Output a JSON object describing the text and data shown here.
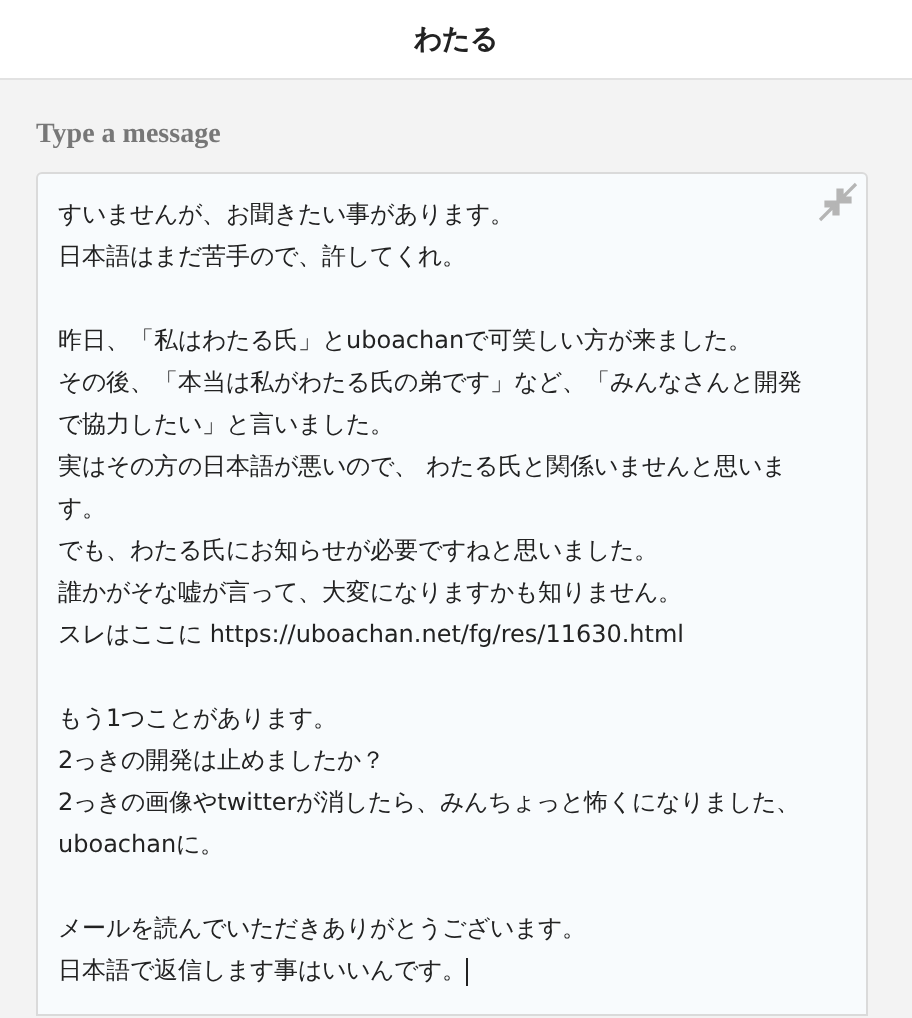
{
  "header": {
    "title": "わたる"
  },
  "composer": {
    "label": "Type a message",
    "paragraphs": [
      [
        "すいませんが、お聞きたい事があります。",
        "日本語はまだ苦手ので、許してくれ。"
      ],
      [
        "昨日、「私はわたる氏」とuboachanで可笑しい方が来ました。",
        "その後、「本当は私がわたる氏の弟です」など、「みんなさんと開発で協力したい」と言いました。",
        "実はその方の日本語が悪いので、 わたる氏と関係いませんと思います。",
        "でも、わたる氏にお知らせが必要ですねと思いました。",
        "誰かがそな嘘が言って、大変になりますかも知りません。",
        "スレはここに https://uboachan.net/fg/res/11630.html"
      ],
      [
        "もう1つことがあります。",
        "2っきの開発は止めましたか？",
        "2っきの画像やtwitterが消したら、みんちょっと怖くになりました、uboachanに。"
      ],
      [
        "メールを読んでいただきありがとうございます。",
        "日本語で返信します事はいいんです。"
      ]
    ]
  }
}
